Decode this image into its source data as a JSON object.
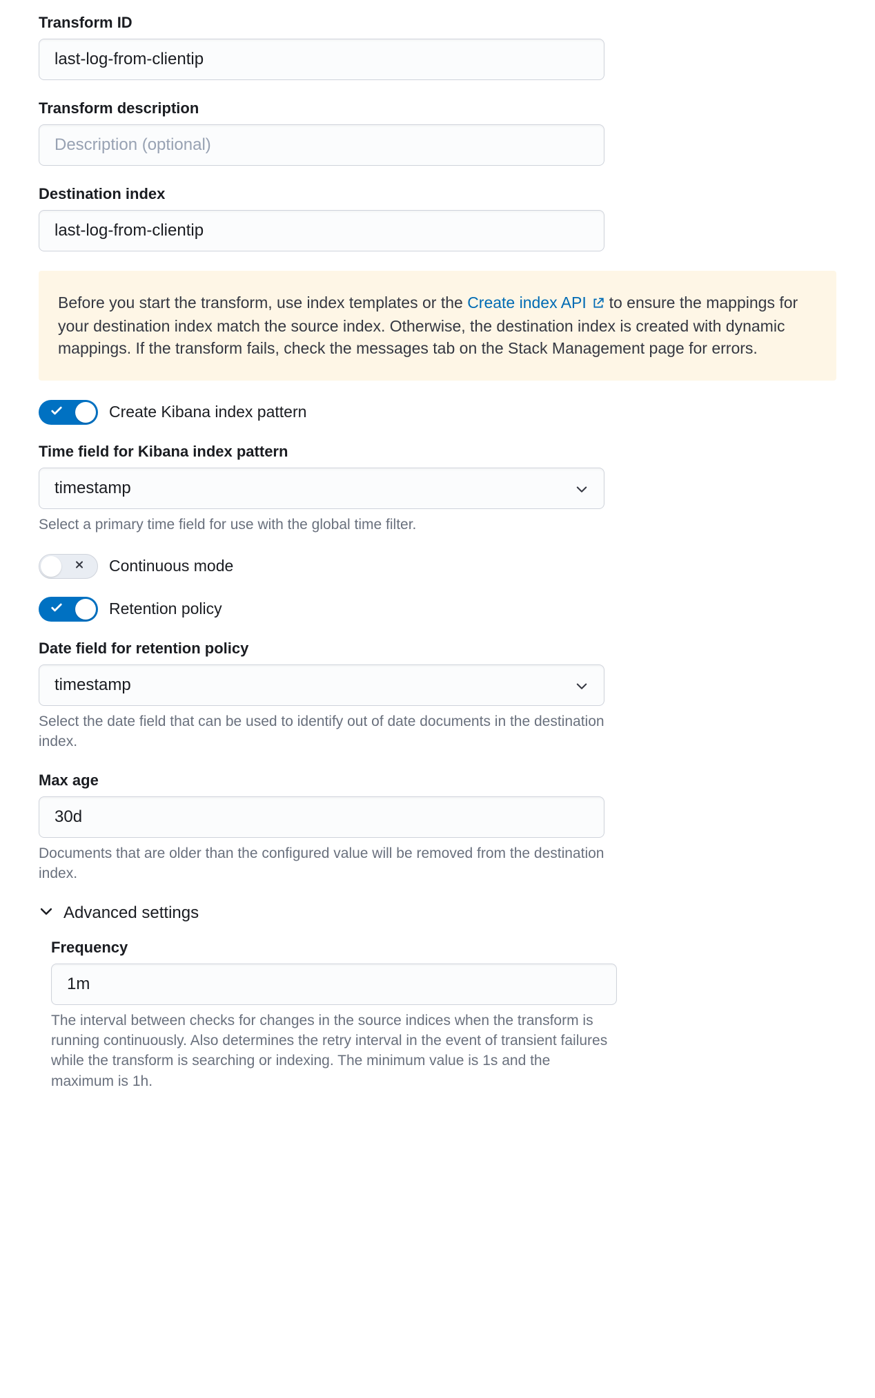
{
  "transform_id": {
    "label": "Transform ID",
    "value": "last-log-from-clientip"
  },
  "transform_description": {
    "label": "Transform description",
    "placeholder": "Description (optional)",
    "value": ""
  },
  "destination_index": {
    "label": "Destination index",
    "value": "last-log-from-clientip"
  },
  "callout": {
    "text_before": "Before you start the transform, use index templates or the ",
    "link_text": "Create index API",
    "text_after": " to ensure the mappings for your destination index match the source index. Otherwise, the destination index is created with dynamic mappings. If the transform fails, check the messages tab on the Stack Management page for errors."
  },
  "create_kibana_index_pattern": {
    "label": "Create Kibana index pattern",
    "on": true
  },
  "time_field": {
    "label": "Time field for Kibana index pattern",
    "value": "timestamp",
    "help": "Select a primary time field for use with the global time filter."
  },
  "continuous_mode": {
    "label": "Continuous mode",
    "on": false
  },
  "retention_policy": {
    "label": "Retention policy",
    "on": true
  },
  "date_field_retention": {
    "label": "Date field for retention policy",
    "value": "timestamp",
    "help": "Select the date field that can be used to identify out of date documents in the destination index."
  },
  "max_age": {
    "label": "Max age",
    "value": "30d",
    "help": "Documents that are older than the configured value will be removed from the destination index."
  },
  "advanced_settings": {
    "label": "Advanced settings"
  },
  "frequency": {
    "label": "Frequency",
    "value": "1m",
    "help": "The interval between checks for changes in the source indices when the transform is running continuously. Also determines the retry interval in the event of transient failures while the transform is searching or indexing. The minimum value is 1s and the maximum is 1h."
  },
  "colors": {
    "link": "#006bb4",
    "accent": "#0071c2"
  }
}
